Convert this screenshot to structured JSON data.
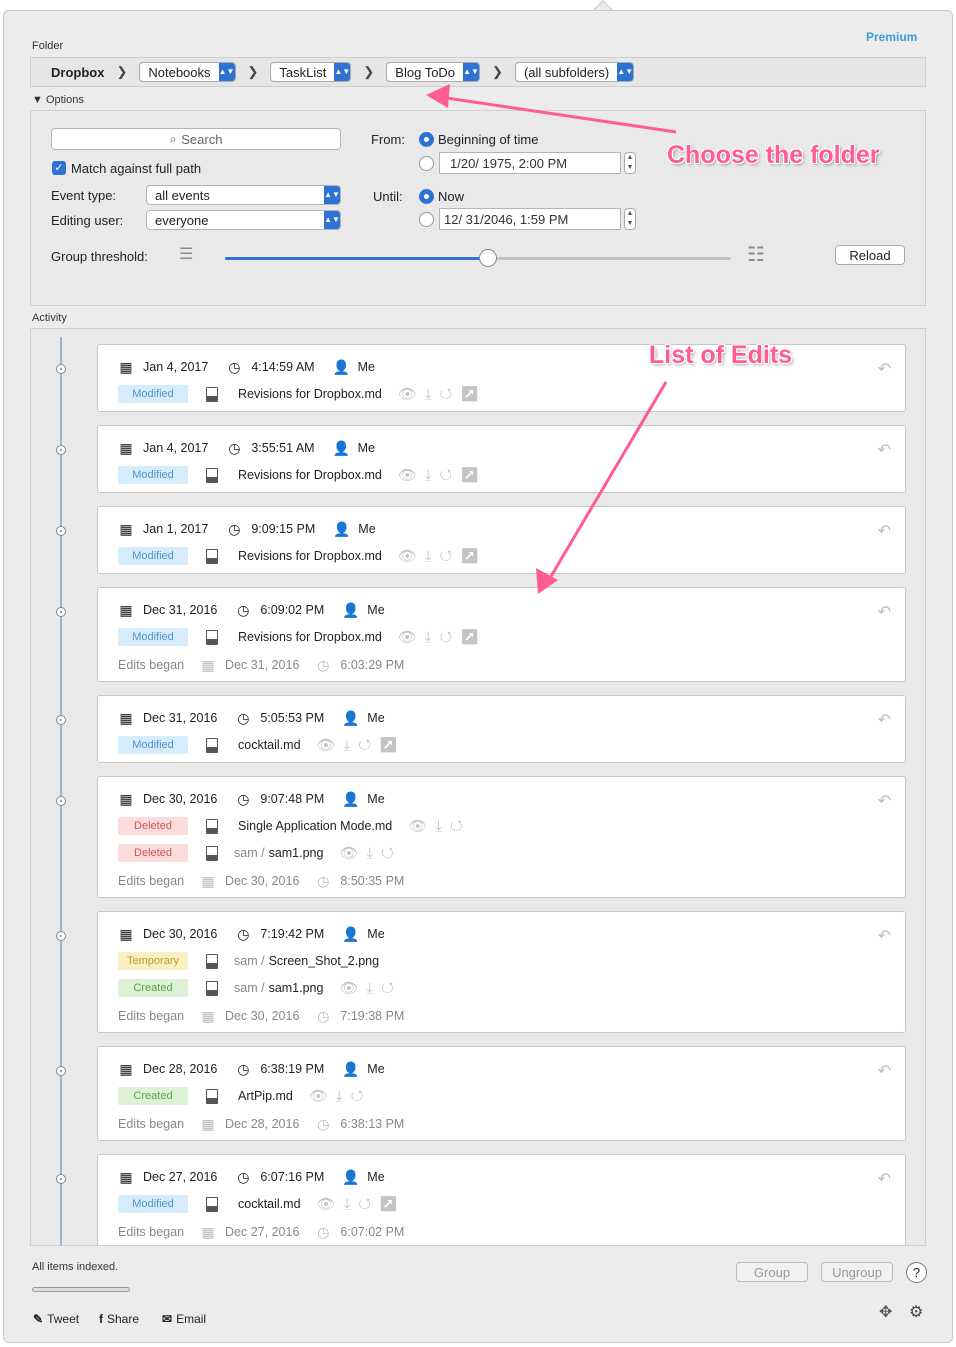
{
  "header": {
    "premium": "Premium",
    "folder_label": "Folder"
  },
  "breadcrumb": {
    "root": "Dropbox",
    "items": [
      "Notebooks",
      "TaskList",
      "Blog ToDo",
      "(all subfolders)"
    ]
  },
  "options": {
    "toggle": "Options",
    "search_placeholder": "Search",
    "match_full_path": "Match against full path",
    "event_type_label": "Event type:",
    "event_type_value": "all events",
    "editing_user_label": "Editing user:",
    "editing_user_value": "everyone",
    "group_threshold_label": "Group threshold:",
    "group_threshold_level": 0.52,
    "from_label": "From:",
    "from_option_1": "Beginning of time",
    "from_date": "1/20/ 1975,   2:00 PM",
    "until_label": "Until:",
    "until_option_1": "Now",
    "until_date": "12/ 31/2046,   1:59 PM",
    "reload": "Reload"
  },
  "activity_label": "Activity",
  "entries": [
    {
      "date": "Jan 4, 2017",
      "time": "4:14:59 AM",
      "user": "Me",
      "rows": [
        {
          "status": "Modified",
          "kind": "mod",
          "dir": "",
          "file": "Revisions for Dropbox.md",
          "actions": "👁⤓↺↗"
        }
      ],
      "began": null
    },
    {
      "date": "Jan 4, 2017",
      "time": "3:55:51 AM",
      "user": "Me",
      "rows": [
        {
          "status": "Modified",
          "kind": "mod",
          "dir": "",
          "file": "Revisions for Dropbox.md",
          "actions": "👁⤓↺↗"
        }
      ],
      "began": null
    },
    {
      "date": "Jan 1, 2017",
      "time": "9:09:15 PM",
      "user": "Me",
      "rows": [
        {
          "status": "Modified",
          "kind": "mod",
          "dir": "",
          "file": "Revisions for Dropbox.md",
          "actions": "👁⤓↺↗"
        }
      ],
      "began": null
    },
    {
      "date": "Dec 31, 2016",
      "time": "6:09:02 PM",
      "user": "Me",
      "rows": [
        {
          "status": "Modified",
          "kind": "mod",
          "dir": "",
          "file": "Revisions for Dropbox.md",
          "actions": "👁⤓↺↗"
        }
      ],
      "began": {
        "label": "Edits began",
        "date": "Dec 31, 2016",
        "time": "6:03:29 PM"
      }
    },
    {
      "date": "Dec 31, 2016",
      "time": "5:05:53 PM",
      "user": "Me",
      "rows": [
        {
          "status": "Modified",
          "kind": "mod",
          "dir": "",
          "file": "cocktail.md",
          "actions": "👁⤓↺↗"
        }
      ],
      "began": null
    },
    {
      "date": "Dec 30, 2016",
      "time": "9:07:48 PM",
      "user": "Me",
      "rows": [
        {
          "status": "Deleted",
          "kind": "del",
          "dir": "",
          "file": "Single Application Mode.md",
          "actions": "👁⤓↺"
        },
        {
          "status": "Deleted",
          "kind": "del",
          "dir": "sam /",
          "file": "sam1.png",
          "actions": "👁⤓↺"
        }
      ],
      "began": {
        "label": "Edits began",
        "date": "Dec 30, 2016",
        "time": "8:50:35 PM"
      }
    },
    {
      "date": "Dec 30, 2016",
      "time": "7:19:42 PM",
      "user": "Me",
      "rows": [
        {
          "status": "Temporary",
          "kind": "tmp",
          "dir": "sam /",
          "file": "Screen_Shot_2.png",
          "actions": ""
        },
        {
          "status": "Created",
          "kind": "cre",
          "dir": "sam /",
          "file": "sam1.png",
          "actions": "👁⤓↺"
        }
      ],
      "began": {
        "label": "Edits began",
        "date": "Dec 30, 2016",
        "time": "7:19:38 PM"
      }
    },
    {
      "date": "Dec 28, 2016",
      "time": "6:38:19 PM",
      "user": "Me",
      "rows": [
        {
          "status": "Created",
          "kind": "cre",
          "dir": "",
          "file": "ArtPip.md",
          "actions": "👁⤓↺"
        }
      ],
      "began": {
        "label": "Edits began",
        "date": "Dec 28, 2016",
        "time": "6:38:13 PM"
      }
    },
    {
      "date": "Dec 27, 2016",
      "time": "6:07:16 PM",
      "user": "Me",
      "rows": [
        {
          "status": "Modified",
          "kind": "mod",
          "dir": "",
          "file": "cocktail.md",
          "actions": "👁⤓↺↗"
        }
      ],
      "began": {
        "label": "Edits began",
        "date": "Dec 27, 2016",
        "time": "6:07:02 PM"
      }
    }
  ],
  "footer": {
    "status": "All items indexed.",
    "group": "Group",
    "ungroup": "Ungroup",
    "help": "?",
    "tweet": "Tweet",
    "share": "Share",
    "email": "Email"
  },
  "annotations": {
    "folder": "Choose the folder",
    "list": "List of Edits"
  },
  "colors": {
    "accent": "#2f72d6",
    "annotation": "#ff5b94"
  }
}
